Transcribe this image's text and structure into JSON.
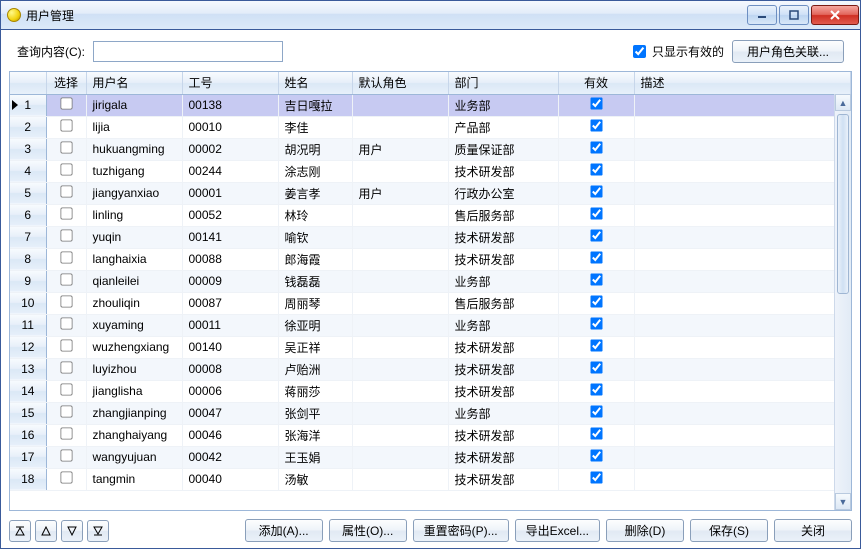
{
  "window": {
    "title": "用户管理"
  },
  "toolbar": {
    "search_label": "查询内容(C):",
    "search_value": "",
    "only_valid_label": "只显示有效的",
    "only_valid_checked": true,
    "role_btn": "用户角色关联..."
  },
  "columns": {
    "index": "",
    "select": "选择",
    "username": "用户名",
    "empno": "工号",
    "name": "姓名",
    "role": "默认角色",
    "dept": "部门",
    "valid": "有效",
    "desc": "描述"
  },
  "rows": [
    {
      "idx": 1,
      "sel": false,
      "user": "jirigala",
      "emp": "00138",
      "name": "吉日嘎拉",
      "role": "",
      "dept": "业务部",
      "valid": true,
      "desc": ""
    },
    {
      "idx": 2,
      "sel": false,
      "user": "lijia",
      "emp": "00010",
      "name": "李佳",
      "role": "",
      "dept": "产品部",
      "valid": true,
      "desc": ""
    },
    {
      "idx": 3,
      "sel": false,
      "user": "hukuangming",
      "emp": "00002",
      "name": "胡况明",
      "role": "用户",
      "dept": "质量保证部",
      "valid": true,
      "desc": ""
    },
    {
      "idx": 4,
      "sel": false,
      "user": "tuzhigang",
      "emp": "00244",
      "name": "涂志刚",
      "role": "",
      "dept": "技术研发部",
      "valid": true,
      "desc": ""
    },
    {
      "idx": 5,
      "sel": false,
      "user": "jiangyanxiao",
      "emp": "00001",
      "name": "姜言孝",
      "role": "用户",
      "dept": "行政办公室",
      "valid": true,
      "desc": ""
    },
    {
      "idx": 6,
      "sel": false,
      "user": "linling",
      "emp": "00052",
      "name": "林玲",
      "role": "",
      "dept": "售后服务部",
      "valid": true,
      "desc": ""
    },
    {
      "idx": 7,
      "sel": false,
      "user": "yuqin",
      "emp": "00141",
      "name": "喻钦",
      "role": "",
      "dept": "技术研发部",
      "valid": true,
      "desc": ""
    },
    {
      "idx": 8,
      "sel": false,
      "user": "langhaixia",
      "emp": "00088",
      "name": "郎海霞",
      "role": "",
      "dept": "技术研发部",
      "valid": true,
      "desc": ""
    },
    {
      "idx": 9,
      "sel": false,
      "user": "qianleilei",
      "emp": "00009",
      "name": "钱磊磊",
      "role": "",
      "dept": "业务部",
      "valid": true,
      "desc": ""
    },
    {
      "idx": 10,
      "sel": false,
      "user": "zhouliqin",
      "emp": "00087",
      "name": "周丽琴",
      "role": "",
      "dept": "售后服务部",
      "valid": true,
      "desc": ""
    },
    {
      "idx": 11,
      "sel": false,
      "user": "xuyaming",
      "emp": "00011",
      "name": "徐亚明",
      "role": "",
      "dept": "业务部",
      "valid": true,
      "desc": ""
    },
    {
      "idx": 12,
      "sel": false,
      "user": "wuzhengxiang",
      "emp": "00140",
      "name": "吴正祥",
      "role": "",
      "dept": "技术研发部",
      "valid": true,
      "desc": ""
    },
    {
      "idx": 13,
      "sel": false,
      "user": "luyizhou",
      "emp": "00008",
      "name": "卢贻洲",
      "role": "",
      "dept": "技术研发部",
      "valid": true,
      "desc": ""
    },
    {
      "idx": 14,
      "sel": false,
      "user": "jianglisha",
      "emp": "00006",
      "name": "蒋丽莎",
      "role": "",
      "dept": "技术研发部",
      "valid": true,
      "desc": ""
    },
    {
      "idx": 15,
      "sel": false,
      "user": "zhangjianping",
      "emp": "00047",
      "name": "张剑平",
      "role": "",
      "dept": "业务部",
      "valid": true,
      "desc": ""
    },
    {
      "idx": 16,
      "sel": false,
      "user": "zhanghaiyang",
      "emp": "00046",
      "name": "张海洋",
      "role": "",
      "dept": "技术研发部",
      "valid": true,
      "desc": ""
    },
    {
      "idx": 17,
      "sel": false,
      "user": "wangyujuan",
      "emp": "00042",
      "name": "王玉娟",
      "role": "",
      "dept": "技术研发部",
      "valid": true,
      "desc": ""
    },
    {
      "idx": 18,
      "sel": false,
      "user": "tangmin",
      "emp": "00040",
      "name": "汤敏",
      "role": "",
      "dept": "技术研发部",
      "valid": true,
      "desc": ""
    }
  ],
  "selected_index": 1,
  "buttons": {
    "add": "添加(A)...",
    "props": "属性(O)...",
    "reset_pwd": "重置密码(P)...",
    "export": "导出Excel...",
    "delete": "删除(D)",
    "save": "保存(S)",
    "close": "关闭"
  },
  "nav_icons": {
    "first": "▲̄",
    "up": "△",
    "down": "▽",
    "last": "▼̄"
  }
}
